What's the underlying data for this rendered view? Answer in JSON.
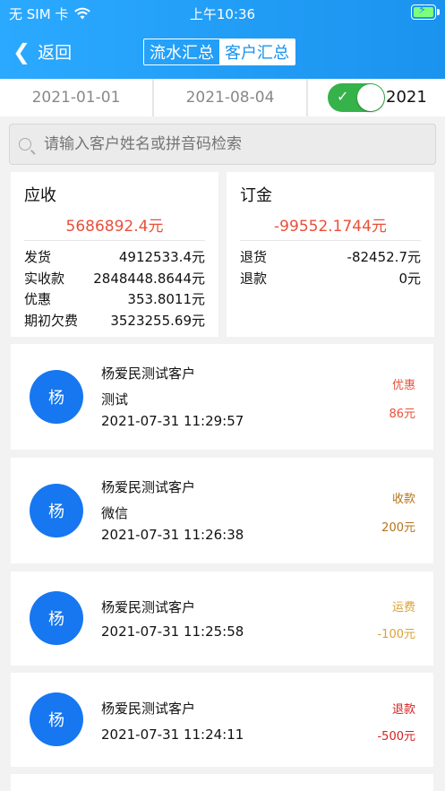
{
  "status_bar": {
    "carrier": "无 SIM 卡",
    "wifi_icon": "wifi-icon",
    "time": "上午10:36",
    "battery_icon": "battery-charging-icon"
  },
  "nav": {
    "back_label": "返回",
    "back_icon": "chevron-left-icon",
    "tabs": [
      {
        "label": "流水汇总",
        "active": false
      },
      {
        "label": "客户汇总",
        "active": true
      }
    ]
  },
  "filter": {
    "start_date": "2021-01-01",
    "end_date": "2021-08-04",
    "toggle_on": true,
    "year": "2021"
  },
  "search": {
    "placeholder": "请输入客户姓名或拼音码检索",
    "icon": "search-icon"
  },
  "receivable": {
    "title": "应收",
    "total": "5686892.4元",
    "rows": [
      {
        "label": "发货",
        "value": "4912533.4元"
      },
      {
        "label": "实收款",
        "value": "2848448.8644元"
      },
      {
        "label": "优惠",
        "value": "353.8011元"
      },
      {
        "label": "期初欠费",
        "value": "3523255.69元"
      }
    ]
  },
  "deposit": {
    "title": "订金",
    "total": "-99552.1744元",
    "rows": [
      {
        "label": "退货",
        "value": "-82452.7元"
      },
      {
        "label": "退款",
        "value": "0元"
      }
    ]
  },
  "records": [
    {
      "avatar": "杨",
      "name": "杨爱民测试客户",
      "note": "测试",
      "time": "2021-07-31 11:29:57",
      "type": "优惠",
      "amount": "86元",
      "color": "#e9503a"
    },
    {
      "avatar": "杨",
      "name": "杨爱民测试客户",
      "note": "微信",
      "time": "2021-07-31 11:26:38",
      "type": "收款",
      "amount": "200元",
      "color": "#b5731c"
    },
    {
      "avatar": "杨",
      "name": "杨爱民测试客户",
      "note": "",
      "time": "2021-07-31 11:25:58",
      "type": "运费",
      "amount": "-100元",
      "color": "#d9a234"
    },
    {
      "avatar": "杨",
      "name": "杨爱民测试客户",
      "note": "",
      "time": "2021-07-31 11:24:11",
      "type": "退款",
      "amount": "-500元",
      "color": "#d42020"
    }
  ]
}
